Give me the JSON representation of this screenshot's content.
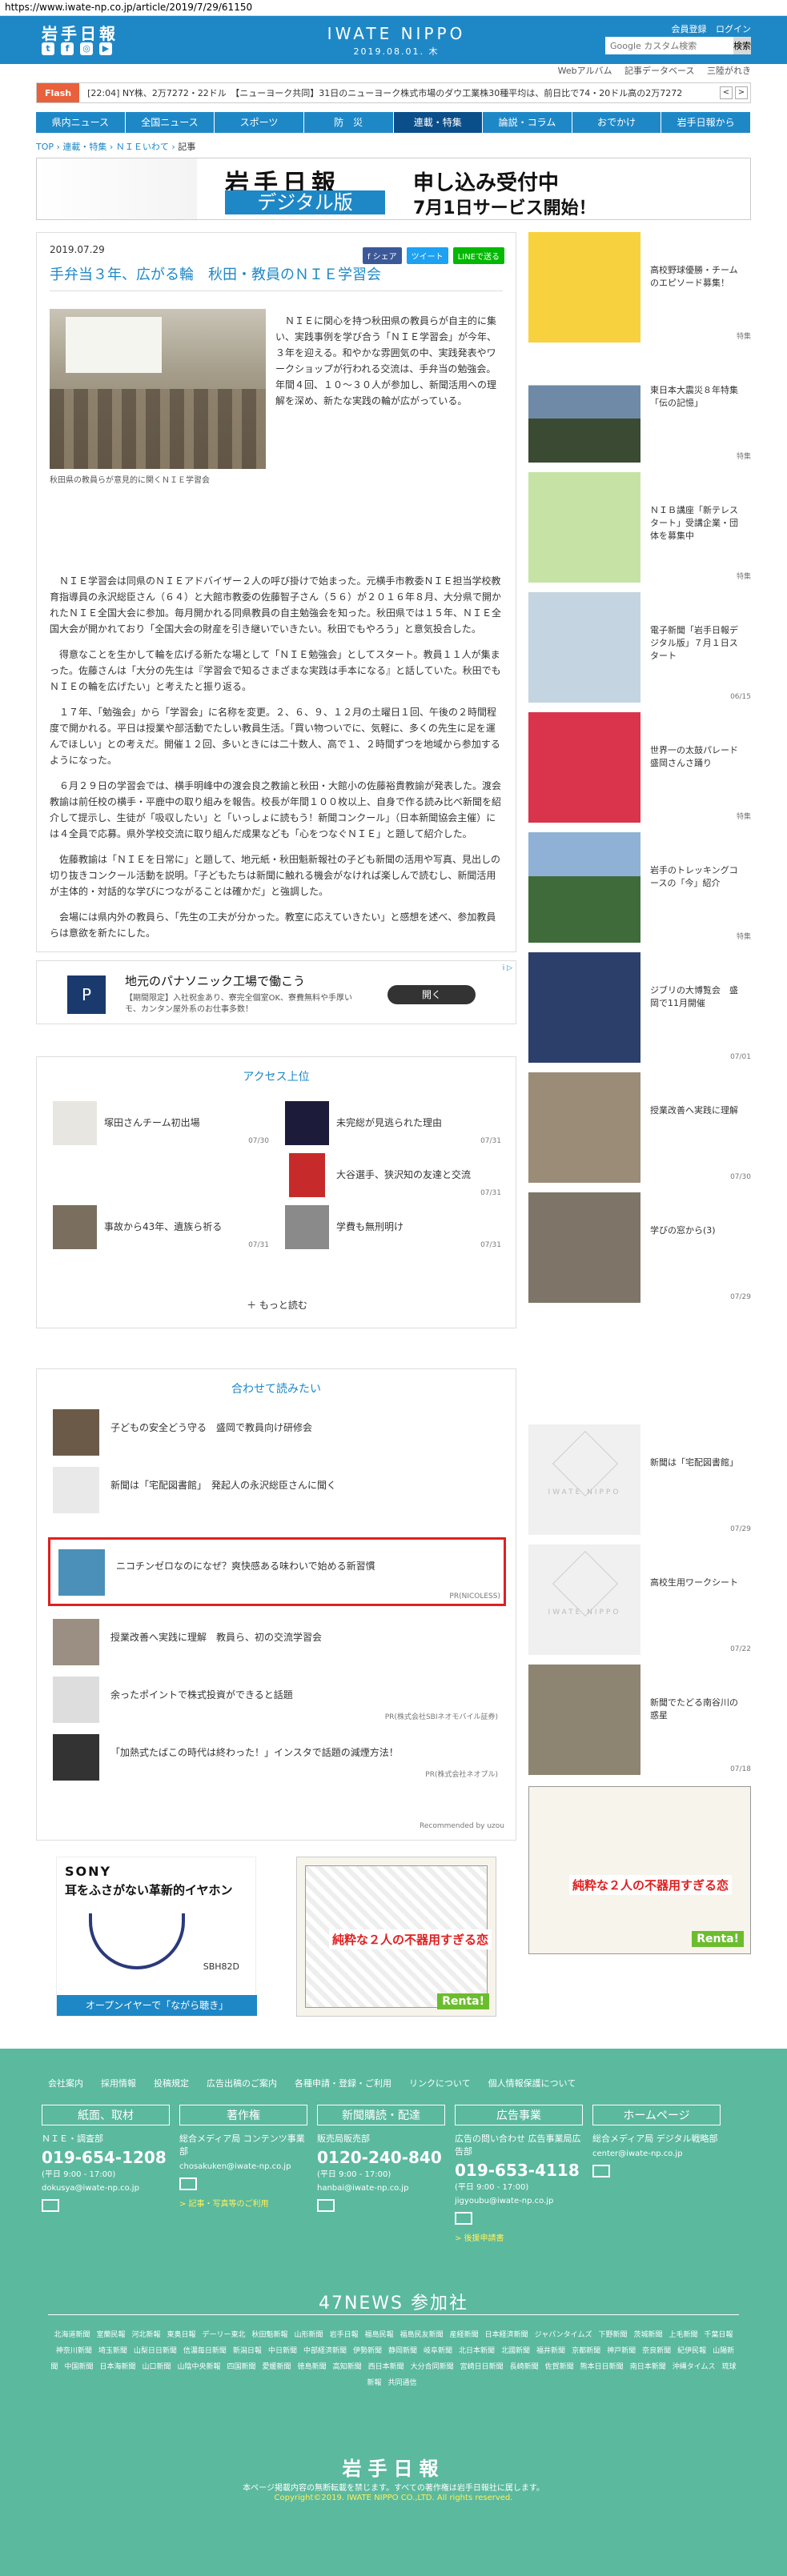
{
  "url": "https://www.iwate-np.co.jp/article/2019/7/29/61150",
  "header": {
    "logo": "岩手日報",
    "brand": "IWATE NIPPO",
    "date": "2019.08.01. 木",
    "links": [
      "会員登録",
      "ログイン"
    ],
    "search_placeholder": "Google カスタム検索",
    "search_button": "検索",
    "social": [
      "t",
      "f",
      "◎",
      "▶"
    ]
  },
  "subnav": [
    "Webアルバム",
    "記事データベース",
    "三陸がれき"
  ],
  "ticker": {
    "flash": "Flash",
    "text": "[22:04] NY株、2万7272・22ドル　【ニューヨーク共同】31日のニューヨーク株式市場のダウ工業株30種平均は、前日比で74・20ドル高の2万7272"
  },
  "mainnav": [
    "県内ニュース",
    "全国ニュース",
    "スポーツ",
    "防　災",
    "連載・特集",
    "論説・コラム",
    "おでかけ",
    "岩手日報から"
  ],
  "breadcrumb": {
    "home": "TOP",
    "l1": "連載・特集",
    "l2": "ＮＩＥいわて",
    "current": "記事"
  },
  "banner": {
    "logo": "岩手日報",
    "digital": "デジタル版",
    "line1": "申し込み受付中",
    "line2": "7月1日サービス開始！"
  },
  "article": {
    "date": "2019.07.29",
    "share": [
      "f シェア",
      "ツイート",
      "LINEで送る"
    ],
    "title": "手弁当３年、広がる輪　秋田・教員のＮＩＥ学習会",
    "caption": "秋田県の教員らが意見的に関くＮＩＥ学習会",
    "lead": "ＮＩＥに関心を持つ秋田県の教員らが自主的に集い、実践事例を学び合う「ＮＩＥ学習会」が今年、３年を迎える。和やかな雰囲気の中、実践発表やワークショップが行われる交流は、手弁当の勉強会。年間４回、１０〜３０人が参加し、新聞活用への理解を深め、新たな実践の輪が広がっている。",
    "paras": [
      "ＮＩＥ学習会は同県のＮＩＥアドバイザー２人の呼び掛けで始まった。元横手市教委ＮＩＥ担当学校教育指導員の永沢総臣さん（６４）と大館市教委の佐藤智子さん（５６）が２０１６年８月、大分県で開かれたＮＩＥ全国大会に参加。毎月開かれる同県教員の自主勉強会を知った。秋田県では１５年、ＮＩＥ全国大会が開かれており「全国大会の財産を引き継いでいきたい。秋田でもやろう」と意気投合した。",
      "得意なことを生かして輪を広げる新たな場として「ＮＩＥ勉強会」としてスタート。教員１１人が集まった。佐藤さんは「大分の先生は『学習会で知るさまざまな実践は手本になる』と話していた。秋田でもＮＩＥの輪を広げたい」と考えたと振り返る。",
      "１７年、「勉強会」から「学習会」に名称を変更。２、６、９、１２月の土曜日１回、午後の２時間程度で開かれる。平日は授業や部活動でたしい教員生活。「買い物ついでに、気軽に、多くの先生に足を運んでほしい」との考えだ。開催１２回、多いときには二十数人、高で１、２時間ずつを地域から参加するようになった。",
      "６月２９日の学習会では、横手明峰中の渡会良之教諭と秋田・大館小の佐藤裕貴教諭が発表した。渡会教諭は前任校の横手・平鹿中の取り組みを報告。校長が年間１００枚以上、自身で作る読み比べ新聞を紹介して提示し、生徒が「吸収したい」と「いっしょに読もう！新聞コンクール」（日本新聞協会主催）には４全員で応募。県外学校交流に取り組んだ成果なども「心をつなぐＮＩＥ」と題して紹介した。",
      "佐藤教諭は「ＮＩＥを日常に」と題して、地元紙・秋田魁新報社の子ども新聞の活用や写真、見出しの切り抜きコンクール活動を説明。「子どもたちは新聞に触れる機会がなければ楽しんで読むし、新聞活用が主体的・対話的な学びにつながることは確かだ」と強調した。",
      "会場には県内外の教員ら、「先生の工夫が分かった。教室に応えていきたい」と感想を述べ、参加教員らは意欲を新たにした。"
    ]
  },
  "ad": {
    "logo": "P",
    "title": "地元のパナソニック工場で働こう",
    "desc": "【期間限定】入社祝金あり、寮完全個室OK、寮費無料や手厚いモ、カンタン屋外系のお仕事多数！",
    "button": "開く",
    "mark": "i ▷"
  },
  "ranking": {
    "title": "アクセス上位",
    "items": [
      {
        "title": "塚田さんチーム初出場",
        "date": "07/30"
      },
      {
        "title": "未完総が見逃られた理由",
        "date": "07/31"
      },
      {
        "title": "",
        "date": ""
      },
      {
        "title": "大谷選手、狭沢知の友達と交流",
        "date": "07/31"
      },
      {
        "title": "事故から43年、遺族ら祈る",
        "date": "07/31"
      },
      {
        "title": "学費も無刑明け",
        "date": "07/31"
      }
    ],
    "more": "もっと読む"
  },
  "recommend": {
    "title": "合わせて読みたい",
    "items": [
      {
        "title": "子どもの安全どう守る　盛岡で教員向け研修会",
        "sponsor": ""
      },
      {
        "title": "新聞は「宅配図書館」　発起人の永沢総臣さんに聞く",
        "sponsor": ""
      },
      {
        "title": "ニコチンゼロなのになぜ？爽快感ある味わいで始める新習慣",
        "sponsor": "PR(NICOLESS)"
      },
      {
        "title": "授業改善へ実践に理解　教員ら、初の交流学習会",
        "sponsor": ""
      },
      {
        "title": "余ったポイントで株式投資ができると話題",
        "sponsor": "PR(株式会社SBIネオモバイル証券)"
      },
      {
        "title": "「加熱式たばこの時代は終わった！」インスタで話題の減煙方法！",
        "sponsor": "PR(株式会社ネオプル)"
      }
    ],
    "powered": "Recommended by uzou"
  },
  "ad_sony": {
    "brand": "SONY",
    "line": "耳をふさがない革新的イヤホン",
    "model": "SBH82D",
    "bar": "オープンイヤーで「ながら聴き」"
  },
  "ad_manga": {
    "catch": "純粋な２人の不器用すぎる恋",
    "label": "Renta!"
  },
  "sidebar": [
    {
      "title": "高校野球優勝・チームのエピソード募集！",
      "date": "特集"
    },
    {
      "title": "東日本大震災８年特集「伝の記憶」",
      "date": "特集"
    },
    {
      "title": "ＮＩＢ講座「新テレスタート」受講企業・団体を募集中",
      "date": "特集"
    },
    {
      "title": "電子新聞「岩手日報デジタル版」７月１日スタート",
      "date": "06/15"
    },
    {
      "title": "世界一の太鼓パレード　盛岡さんさ踊り",
      "date": "特集"
    },
    {
      "title": "岩手のトレッキングコースの「今」紹介",
      "date": "特集"
    },
    {
      "title": "ジブリの大博覧会　盛岡で11月開催",
      "date": "07/01"
    },
    {
      "title": "授業改善へ実践に理解",
      "date": "07/30"
    },
    {
      "title": "学びの窓から(3)",
      "date": "07/29"
    },
    {
      "title": "新聞は「宅配図書館」",
      "date": "07/29"
    },
    {
      "title": "高校生用ワークシート",
      "date": "07/22"
    },
    {
      "title": "新聞でたどる南谷川の惑星",
      "date": "07/18"
    }
  ],
  "footer": {
    "links": [
      "会社案内",
      "採用情報",
      "投稿規定",
      "広告出稿のご案内",
      "各種申請・登録・ご利用",
      "リンクについて",
      "個人情報保護について"
    ],
    "cols": [
      {
        "head": "紙面、取材",
        "sub": "ＮＩＥ・調査部",
        "tel": "019-654-1208",
        "hours": "(平日 9:00 - 17:00)",
        "mail": "dokusya@iwate-np.co.jp",
        "extra": ""
      },
      {
        "head": "著作権",
        "sub": "総合メディア局 コンテンツ事業部",
        "tel": "",
        "hours": "",
        "mail": "chosakuken@iwate-np.co.jp",
        "extra": "> 記事・写真等のご利用"
      },
      {
        "head": "新聞購読・配達",
        "sub": "販売局販売部",
        "tel": "0120-240-840",
        "hours": "(平日 9:00 - 17:00)",
        "mail": "hanbai@iwate-np.co.jp",
        "extra": ""
      },
      {
        "head": "広告事業",
        "sub": "広告の問い合わせ 広告事業局広告部",
        "tel": "019-653-4118",
        "hours": "(平日 9:00 - 17:00)",
        "mail": "jigyoubu@iwate-np.co.jp",
        "extra": "> 後援申請書"
      },
      {
        "head": "ホームページ",
        "sub": "総合メディア局 デジタル戦略部",
        "tel": "",
        "hours": "",
        "mail": "center@iwate-np.co.jp",
        "extra": ""
      }
    ],
    "n47": "47NEWS 参加社",
    "papers": [
      "北海道新聞",
      "室蘭民報",
      "河北新報",
      "東奥日報",
      "デーリー東北",
      "秋田魁新報",
      "山形新聞",
      "岩手日報",
      "福島民報",
      "福島民友新聞",
      "産経新聞",
      "日本経済新聞",
      "ジャパンタイムズ",
      "下野新聞",
      "茨城新聞",
      "上毛新聞",
      "千葉日報",
      "神奈川新聞",
      "埼玉新聞",
      "山梨日日新聞",
      "信濃毎日新聞",
      "新潟日報",
      "中日新聞",
      "中部経済新聞",
      "伊勢新聞",
      "静岡新聞",
      "岐阜新聞",
      "北日本新聞",
      "北國新聞",
      "福井新聞",
      "京都新聞",
      "神戸新聞",
      "奈良新聞",
      "紀伊民報",
      "山陽新聞",
      "中国新聞",
      "日本海新聞",
      "山口新聞",
      "山陰中央新報",
      "四国新聞",
      "愛媛新聞",
      "徳島新聞",
      "高知新聞",
      "西日本新聞",
      "大分合同新聞",
      "宮崎日日新聞",
      "長崎新聞",
      "佐賀新聞",
      "熊本日日新聞",
      "南日本新聞",
      "沖縄タイムス",
      "琉球新報",
      "共同通信"
    ],
    "logo": "岩手日報",
    "copy1": "本ページ掲載内容の無断転載を禁じます。すべての著作権は岩手日報社に属します。",
    "copy2": "Copyright©2019. IWATE NIPPO CO.,LTD. All rights reserved."
  }
}
